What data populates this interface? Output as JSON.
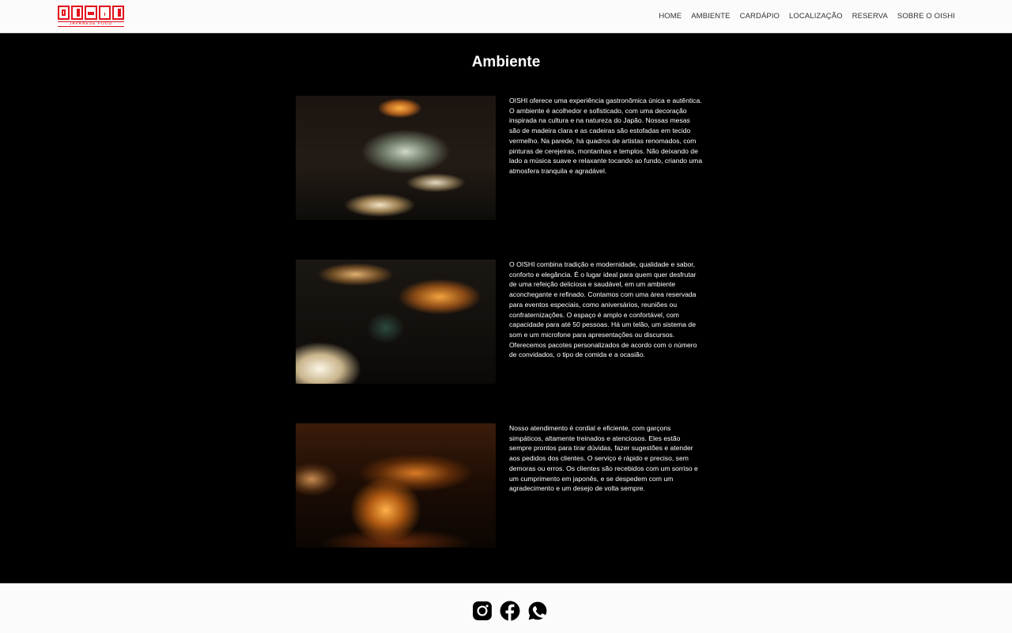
{
  "brand": {
    "logo_text": "OISHI",
    "tagline": "JAPANESE FOOD",
    "color": "#e3121c"
  },
  "nav": {
    "items": [
      {
        "label": "HOME"
      },
      {
        "label": "AMBIENTE"
      },
      {
        "label": "CARDÁPIO"
      },
      {
        "label": "LOCALIZAÇÃO"
      },
      {
        "label": "RESERVA"
      },
      {
        "label": "SOBRE O OISHI"
      }
    ]
  },
  "main": {
    "title": "Ambiente",
    "sections": [
      {
        "image": "restaurant-interior-photo-1",
        "text": "OISHI oferece uma experiência gastronômica única e autêntica. O ambiente é acolhedor e sofisticado, com uma decoração inspirada na cultura e na natureza do Japão. Nossas mesas são de madeira clara e as cadeiras são estofadas em tecido vermelho. Na parede, há quadros de artistas renomados, com pinturas de cerejeiras, montanhas e templos. Não deixando de lado a música suave e relaxante tocando ao fundo, criando uma atmosfera tranquila e agradável."
      },
      {
        "image": "restaurant-interior-photo-2",
        "text": "O OISHI combina tradição e modernidade, qualidade e sabor, conforto e elegância. É o lugar ideal para quem quer desfrutar de uma refeição deliciosa e saudável, em um ambiente aconchegante e refinado. Contamos com uma área reservada para eventos especiais, como aniversários, reuniões ou confraternizações. O espaço é amplo e confortável, com capacidade para até 50 pessoas. Há um telão, um sistema de som e um microfone para apresentações ou discursos. Oferecemos pacotes personalizados de acordo com o número de convidados, o tipo de comida e a ocasião."
      },
      {
        "image": "restaurant-interior-photo-3",
        "text": "Nosso atendimento é cordial e eficiente, com garçons simpáticos, altamente treinados e atenciosos. Eles estão sempre prontos para tirar dúvidas, fazer sugestões e atender aos pedidos dos clientes. O serviço é rápido e preciso, sem demoras ou erros. Os clientes são recebidos com um sorriso e um cumprimento em japonês, e se despedem com um agradecimento e um desejo de volta sempre."
      }
    ]
  },
  "footer": {
    "social": [
      {
        "icon": "instagram-icon"
      },
      {
        "icon": "facebook-icon"
      },
      {
        "icon": "whatsapp-icon"
      }
    ]
  }
}
